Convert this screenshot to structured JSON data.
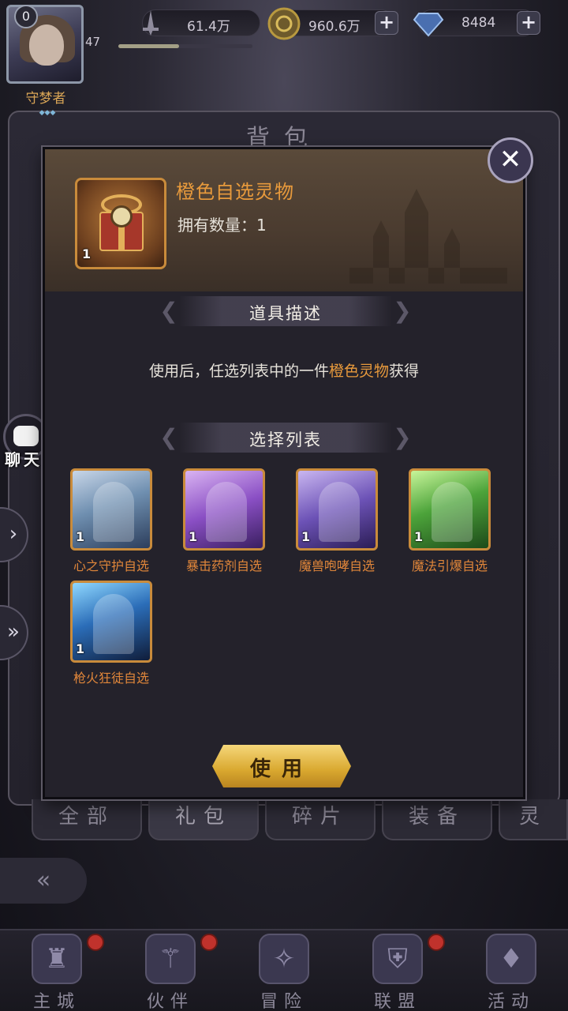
{
  "top_bar": {
    "level_badge": "0",
    "player_name": "守梦者",
    "name_dots": "◆◆◆",
    "level": "47",
    "exp_fraction": 0.45,
    "power": "61.4万",
    "gold": "960.6万",
    "gems": "8484",
    "plus": "+"
  },
  "background": {
    "panel_title": "背包"
  },
  "side": {
    "chat_label": "聊天",
    "tab1_icon": "›",
    "tab2_icon": "»"
  },
  "modal": {
    "item_name": "橙色自选灵物",
    "item_count_prefix": "拥有数量：",
    "item_count": "1",
    "item_badge_qty": "1",
    "desc_section_title": "道具描述",
    "desc_pre": "使用后，任选列表中的一件",
    "desc_highlight": "橙色灵物",
    "desc_post": "获得",
    "choice_section_title": "选择列表",
    "choices": [
      {
        "label": "心之守护自选",
        "qty": "1"
      },
      {
        "label": "暴击药剂自选",
        "qty": "1"
      },
      {
        "label": "魔兽咆哮自选",
        "qty": "1"
      },
      {
        "label": "魔法引爆自选",
        "qty": "1"
      },
      {
        "label": "枪火狂徒自选",
        "qty": "1"
      }
    ],
    "use_button": "使用",
    "close_icon": "✕"
  },
  "bag_tabs": [
    "全部",
    "礼包",
    "碎片",
    "装备",
    "灵"
  ],
  "bag_tab_active": "礼包",
  "back_icon": "«",
  "bottom_nav": [
    {
      "label": "主城",
      "icon": "castle-icon",
      "glyph": "♜",
      "dot": true
    },
    {
      "label": "伙伴",
      "icon": "hat-icon",
      "glyph": "⚚",
      "dot": true
    },
    {
      "label": "冒险",
      "icon": "compass-icon",
      "glyph": "✧",
      "dot": false
    },
    {
      "label": "联盟",
      "icon": "shield-icon",
      "glyph": "⛨",
      "dot": true
    },
    {
      "label": "活动",
      "icon": "cards-icon",
      "glyph": "♦",
      "dot": false
    }
  ],
  "colors": {
    "accent_orange": "#e89a3c",
    "button_gold": "#d9a82f",
    "notification_red": "#c0322c"
  }
}
